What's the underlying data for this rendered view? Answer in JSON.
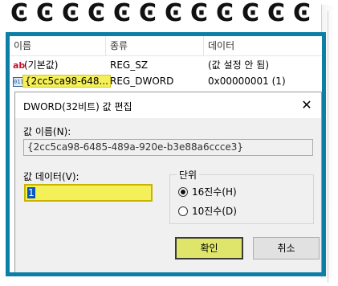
{
  "registry": {
    "columns": [
      "이름",
      "종류",
      "데이터"
    ],
    "rows": [
      {
        "icon": "string-value-icon",
        "name": "(기본값)",
        "type": "REG_SZ",
        "data": "(값 설정 안 됨)"
      },
      {
        "icon": "binary-value-icon",
        "name": "{2cc5ca98-648...",
        "type": "REG_DWORD",
        "data": "0x00000001 (1)"
      }
    ]
  },
  "dialog": {
    "title": "DWORD(32비트) 값 편집",
    "close_glyph": "✕",
    "value_name_label": "값 이름(N):",
    "value_name": "{2cc5ca98-6485-489a-920e-b3e88a6ccce3}",
    "value_data_label": "값 데이터(V):",
    "value_data": "1",
    "base_group_label": "단위",
    "base_options": [
      {
        "label": "16진수(H)",
        "selected": true
      },
      {
        "label": "10진수(D)",
        "selected": false
      }
    ],
    "ok_label": "확인",
    "cancel_label": "취소"
  },
  "colors": {
    "frame": "#0d7fa6",
    "highlight": "#f4f05a",
    "ok_button": "#dfe56a"
  }
}
